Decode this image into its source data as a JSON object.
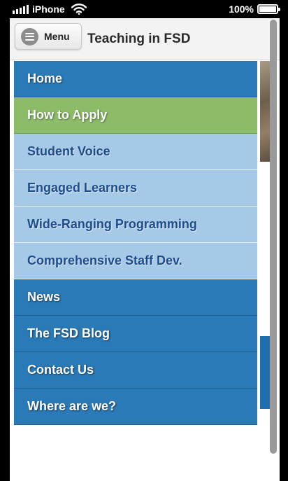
{
  "status_bar": {
    "carrier": "iPhone",
    "battery_percent": "100%",
    "icons": [
      "signal-icon",
      "wifi-icon",
      "battery-icon"
    ]
  },
  "header": {
    "menu_button_label": "Menu",
    "site_title": "Teaching in FSD",
    "menu_icon": "hamburger-icon"
  },
  "nav": {
    "items": [
      {
        "label": "Home",
        "style": "primary"
      },
      {
        "label": "How to Apply",
        "style": "active"
      },
      {
        "label": "Student Voice",
        "style": "sub"
      },
      {
        "label": "Engaged Learners",
        "style": "sub"
      },
      {
        "label": "Wide-Ranging Programming",
        "style": "sub"
      },
      {
        "label": "Comprehensive Staff Dev.",
        "style": "sub"
      },
      {
        "label": "News",
        "style": "primary"
      },
      {
        "label": "The FSD Blog",
        "style": "primary"
      },
      {
        "label": "Contact Us",
        "style": "primary"
      },
      {
        "label": "Where are we?",
        "style": "primary"
      }
    ]
  },
  "colors": {
    "primary": "#2a7ab7",
    "active": "#8cbc68",
    "sub": "#a7c9e8",
    "sub_text": "#1d4d8b"
  }
}
